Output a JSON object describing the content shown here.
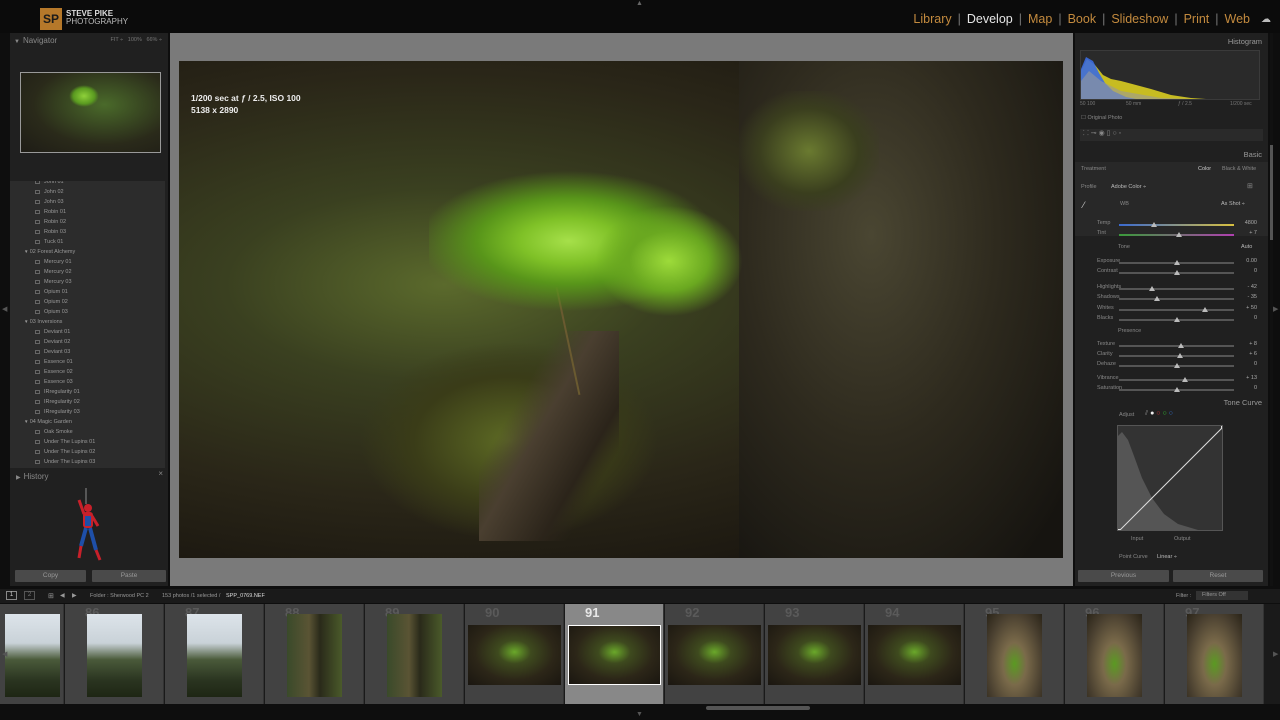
{
  "brand": {
    "initials": "SP",
    "name": "STEVE PIKE",
    "subname": "PHOTOGRAPHY",
    "color": "#b5782a"
  },
  "modules": [
    "Library",
    "Develop",
    "Map",
    "Book",
    "Slideshow",
    "Print",
    "Web"
  ],
  "active_module": "Develop",
  "navigator": {
    "title": "Navigator",
    "zoom": [
      "FIT ÷",
      "100%",
      "66% ÷"
    ]
  },
  "collections": [
    {
      "label": "John 01",
      "type": "sub"
    },
    {
      "label": "John 02",
      "type": "sub"
    },
    {
      "label": "John 03",
      "type": "sub"
    },
    {
      "label": "Robin 01",
      "type": "sub"
    },
    {
      "label": "Robin 02",
      "type": "sub"
    },
    {
      "label": "Robin 03",
      "type": "sub"
    },
    {
      "label": "Tuck 01",
      "type": "sub"
    },
    {
      "label": "02 Forest Alchemy",
      "type": "grp"
    },
    {
      "label": "Mercury 01",
      "type": "sub"
    },
    {
      "label": "Mercury 02",
      "type": "sub"
    },
    {
      "label": "Mercury 03",
      "type": "sub"
    },
    {
      "label": "Opium 01",
      "type": "sub"
    },
    {
      "label": "Opium 02",
      "type": "sub"
    },
    {
      "label": "Opium 03",
      "type": "sub"
    },
    {
      "label": "03 Inversions",
      "type": "grp"
    },
    {
      "label": "Deviant 01",
      "type": "sub"
    },
    {
      "label": "Deviant 02",
      "type": "sub"
    },
    {
      "label": "Deviant 03",
      "type": "sub"
    },
    {
      "label": "Essence 01",
      "type": "sub"
    },
    {
      "label": "Essence 02",
      "type": "sub"
    },
    {
      "label": "Essence 03",
      "type": "sub"
    },
    {
      "label": "IRregularity 01",
      "type": "sub"
    },
    {
      "label": "IRregularity 02",
      "type": "sub"
    },
    {
      "label": "IRregularity 03",
      "type": "sub"
    },
    {
      "label": "04 Magic Garden",
      "type": "grp"
    },
    {
      "label": "Oak Smoke",
      "type": "sub"
    },
    {
      "label": "Under The Lupins 01",
      "type": "sub"
    },
    {
      "label": "Under The Lupins 02",
      "type": "sub"
    },
    {
      "label": "Under The Lupins 03",
      "type": "sub"
    }
  ],
  "history": {
    "title": "History",
    "close": "×"
  },
  "buttons": {
    "copy": "Copy",
    "paste": "Paste",
    "previous": "Previous",
    "reset": "Reset"
  },
  "photo_info": {
    "exposure": "1/200 sec at ƒ / 2.5, ISO 100",
    "dimensions": "5138 x 2890"
  },
  "histogram": {
    "title": "Histogram",
    "info": [
      "50 100",
      "50 mm",
      "ƒ / 2.5",
      "1/200 sec"
    ],
    "original_photo": "Original Photo"
  },
  "basic": {
    "title": "Basic",
    "treatment_label": "Treatment",
    "treatment_color": "Color",
    "treatment_bw": "Black & White",
    "profile_label": "Profile",
    "profile_value": "Adobe Color ÷",
    "wb_label": "WB",
    "wb_value": "As Shot ÷",
    "tone_label": "Tone",
    "auto": "Auto",
    "presence_label": "Presence",
    "sliders": [
      {
        "label": "Temp",
        "value": "4800",
        "pos": 0.3
      },
      {
        "label": "Tint",
        "value": "+ 7",
        "pos": 0.52
      },
      {
        "label": "Exposure",
        "value": "0.00",
        "pos": 0.5
      },
      {
        "label": "Contrast",
        "value": "0",
        "pos": 0.5
      },
      {
        "label": "Highlights",
        "value": "- 42",
        "pos": 0.29
      },
      {
        "label": "Shadows",
        "value": "- 35",
        "pos": 0.33
      },
      {
        "label": "Whites",
        "value": "+ 50",
        "pos": 0.75
      },
      {
        "label": "Blacks",
        "value": "0",
        "pos": 0.5
      },
      {
        "label": "Texture",
        "value": "+ 8",
        "pos": 0.54
      },
      {
        "label": "Clarity",
        "value": "+ 6",
        "pos": 0.53
      },
      {
        "label": "Dehaze",
        "value": "0",
        "pos": 0.5
      },
      {
        "label": "Vibrance",
        "value": "+ 13",
        "pos": 0.57
      },
      {
        "label": "Saturation",
        "value": "0",
        "pos": 0.5
      }
    ]
  },
  "tone_curve": {
    "title": "Tone Curve",
    "adjust": "Adjust",
    "input": "Input",
    "output": "Output",
    "point_curve_label": "Point Curve",
    "point_curve_value": "Linear ÷"
  },
  "filmstrip_bar": {
    "view1": "1",
    "view2": "2",
    "folder": "Folder : Sherwood PC 2",
    "count": "153 photos /1 selected /",
    "filename": "SPP_0769.NEF",
    "filter_label": "Filter :",
    "filter_value": "Filters Off"
  },
  "filmstrip": [
    {
      "num": "",
      "kind": "tree"
    },
    {
      "num": "86",
      "kind": "tree"
    },
    {
      "num": "87",
      "kind": "tree"
    },
    {
      "num": "88",
      "kind": "tree2"
    },
    {
      "num": "89",
      "kind": "tree2"
    },
    {
      "num": "90",
      "kind": "fern"
    },
    {
      "num": "91",
      "kind": "fern",
      "selected": true
    },
    {
      "num": "92",
      "kind": "fern"
    },
    {
      "num": "93",
      "kind": "fern"
    },
    {
      "num": "94",
      "kind": "fern"
    },
    {
      "num": "95",
      "kind": "fernv"
    },
    {
      "num": "96",
      "kind": "fernv"
    },
    {
      "num": "97",
      "kind": "fernv"
    }
  ]
}
